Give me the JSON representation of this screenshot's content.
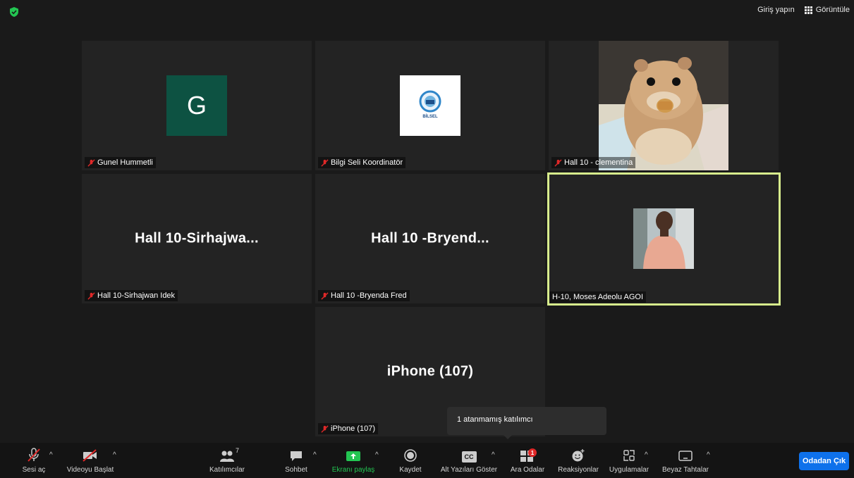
{
  "topbar": {
    "signin_label": "Giriş yapın",
    "view_label": "Görüntüle"
  },
  "participants": [
    {
      "name": "Gunel Hummetli",
      "avatar_letter": "G"
    },
    {
      "name": "Bilgi Seli Koordinatör",
      "logo_text": "BİLSEL"
    },
    {
      "name": "Hall 10 - clementina"
    },
    {
      "name": "Hall 10-Sirhajwan Idek",
      "display": "Hall  10-Sirhajwa..."
    },
    {
      "name": "Hall 10 -Bryenda Fred",
      "display": "Hall 10 -Bryend..."
    },
    {
      "name": "H-10, Moses Adeolu AGOI"
    },
    {
      "name": "iPhone (107)",
      "display": "iPhone (107)"
    }
  ],
  "tooltip": {
    "text": "1 atanmamış katılımcı"
  },
  "toolbar": {
    "audio": "Sesi aç",
    "video": "Videoyu Başlat",
    "participants": "Katılımcılar",
    "participants_count": "7",
    "chat": "Sohbet",
    "share": "Ekranı paylaş",
    "record": "Kaydet",
    "captions": "Alt Yazıları Göster",
    "captions_icon_text": "CC",
    "breakout": "Ara Odalar",
    "breakout_badge": "1",
    "reactions": "Reaksiyonlar",
    "apps": "Uygulamalar",
    "whiteboard": "Beyaz Tahtalar",
    "leave": "Odadan Çık"
  },
  "colors": {
    "accent": "#0e71eb",
    "active_speaker": "#d7ec8c",
    "share_green": "#23c552",
    "muted_red": "#e02828"
  }
}
